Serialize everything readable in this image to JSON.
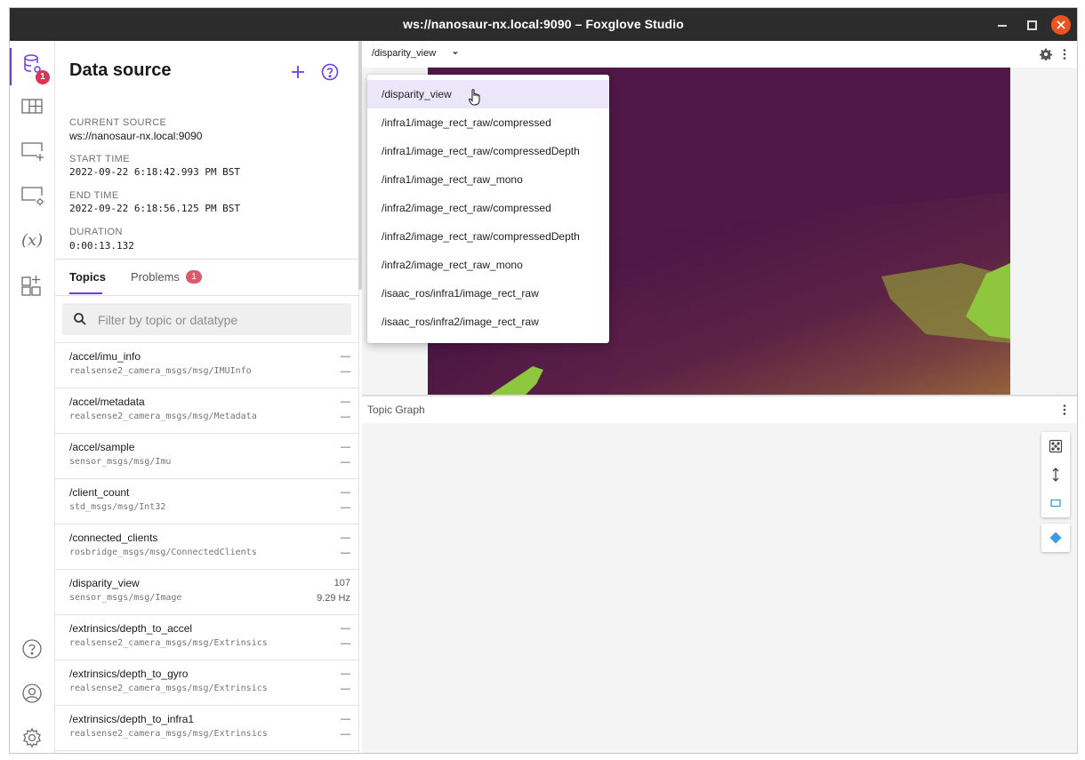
{
  "window": {
    "title": "ws://nanosaur-nx.local:9090 – Foxglove Studio"
  },
  "nav": {
    "datasource_badge": "1",
    "items": [
      {
        "name": "data-source",
        "icon": "database-icon"
      },
      {
        "name": "layouts",
        "icon": "layout-grid-icon"
      },
      {
        "name": "add-panel",
        "icon": "add-panel-icon"
      },
      {
        "name": "panel-settings",
        "icon": "panel-settings-icon"
      },
      {
        "name": "variables",
        "icon": "variables-icon"
      },
      {
        "name": "extensions",
        "icon": "extensions-icon"
      },
      {
        "name": "help",
        "icon": "help-icon"
      },
      {
        "name": "account",
        "icon": "account-icon"
      },
      {
        "name": "preferences",
        "icon": "gear-icon"
      }
    ]
  },
  "datasource": {
    "title": "Data source",
    "current_source_label": "CURRENT SOURCE",
    "current_source": "ws://nanosaur-nx.local:9090",
    "start_time_label": "START TIME",
    "start_time": "2022-09-22 6:18:42.993 PM BST",
    "end_time_label": "END TIME",
    "end_time": "2022-09-22 6:18:56.125 PM BST",
    "duration_label": "DURATION",
    "duration": "0:00:13.132"
  },
  "tabs": {
    "topics": "Topics",
    "problems": "Problems",
    "problems_count": "1"
  },
  "filter": {
    "placeholder": "Filter by topic or datatype",
    "value": ""
  },
  "topics": [
    {
      "name": "/accel/imu_info",
      "type": "realsense2_camera_msgs/msg/IMUInfo",
      "count": "—",
      "freq": "—"
    },
    {
      "name": "/accel/metadata",
      "type": "realsense2_camera_msgs/msg/Metadata",
      "count": "—",
      "freq": "—"
    },
    {
      "name": "/accel/sample",
      "type": "sensor_msgs/msg/Imu",
      "count": "—",
      "freq": "—"
    },
    {
      "name": "/client_count",
      "type": "std_msgs/msg/Int32",
      "count": "—",
      "freq": "—"
    },
    {
      "name": "/connected_clients",
      "type": "rosbridge_msgs/msg/ConnectedClients",
      "count": "—",
      "freq": "—"
    },
    {
      "name": "/disparity_view",
      "type": "sensor_msgs/msg/Image",
      "count": "107",
      "freq": "9.29 Hz"
    },
    {
      "name": "/extrinsics/depth_to_accel",
      "type": "realsense2_camera_msgs/msg/Extrinsics",
      "count": "—",
      "freq": "—"
    },
    {
      "name": "/extrinsics/depth_to_gyro",
      "type": "realsense2_camera_msgs/msg/Extrinsics",
      "count": "—",
      "freq": "—"
    },
    {
      "name": "/extrinsics/depth_to_infra1",
      "type": "realsense2_camera_msgs/msg/Extrinsics",
      "count": "—",
      "freq": "—"
    }
  ],
  "image_panel": {
    "selected_topic": "/disparity_view"
  },
  "dropdown": {
    "items": [
      "/disparity_view",
      "/infra1/image_rect_raw/compressed",
      "/infra1/image_rect_raw/compressedDepth",
      "/infra1/image_rect_raw_mono",
      "/infra2/image_rect_raw/compressed",
      "/infra2/image_rect_raw/compressedDepth",
      "/infra2/image_rect_raw_mono",
      "/isaac_ros/infra1/image_rect_raw",
      "/isaac_ros/infra2/image_rect_raw"
    ],
    "selected_index": 0
  },
  "graph_panel": {
    "title": "Topic Graph"
  },
  "colors": {
    "accent": "#6f3be8",
    "badge": "#db3553",
    "close_button": "#e95420",
    "titlebar": "#2c2c2c",
    "image_dark": "#4e1746",
    "image_warm": "#9d6a3a",
    "image_green": "#8ec63d"
  }
}
